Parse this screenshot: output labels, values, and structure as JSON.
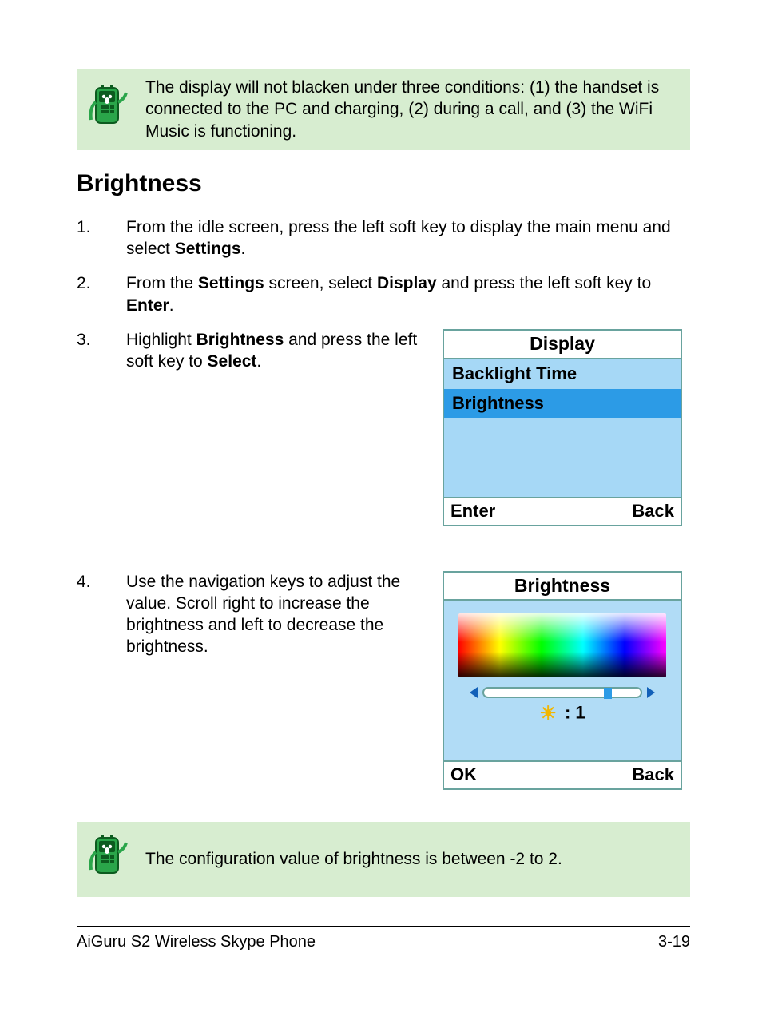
{
  "note1": "The display will not blacken under three conditions: (1) the handset is connected to the PC and charging, (2) during a call, and (3) the WiFi Music is functioning.",
  "heading": "Brightness",
  "steps": {
    "s1_num": "1.",
    "s1_a": "From the idle screen, press the left soft key to display the main menu and select ",
    "s1_b": "Settings",
    "s1_c": ".",
    "s2_num": "2.",
    "s2_a": "From the ",
    "s2_b": "Settings",
    "s2_c": " screen, select ",
    "s2_d": "Display",
    "s2_e": " and press the left soft key to ",
    "s2_f": "Enter",
    "s2_g": ".",
    "s3_num": "3.",
    "s3_a": "Highlight ",
    "s3_b": "Brightness",
    "s3_c": " and press the left soft key to ",
    "s3_d": "Select",
    "s3_e": ".",
    "s4_num": "4.",
    "s4_text": "Use the navigation keys to adjust the value. Scroll right to increase the brightness and left to decrease the brightness."
  },
  "screen1": {
    "title": "Display",
    "item1": "Backlight Time",
    "item2": "Brightness",
    "sk_left": "Enter",
    "sk_right": "Back"
  },
  "screen2": {
    "title": "Brightness",
    "value_sep": " : ",
    "value": "1",
    "sk_left": "OK",
    "sk_right": "Back"
  },
  "note2": "The configuration value of brightness is between -2 to 2.",
  "footer": {
    "left": "AiGuru S2 Wireless Skype Phone",
    "right": "3-19"
  }
}
